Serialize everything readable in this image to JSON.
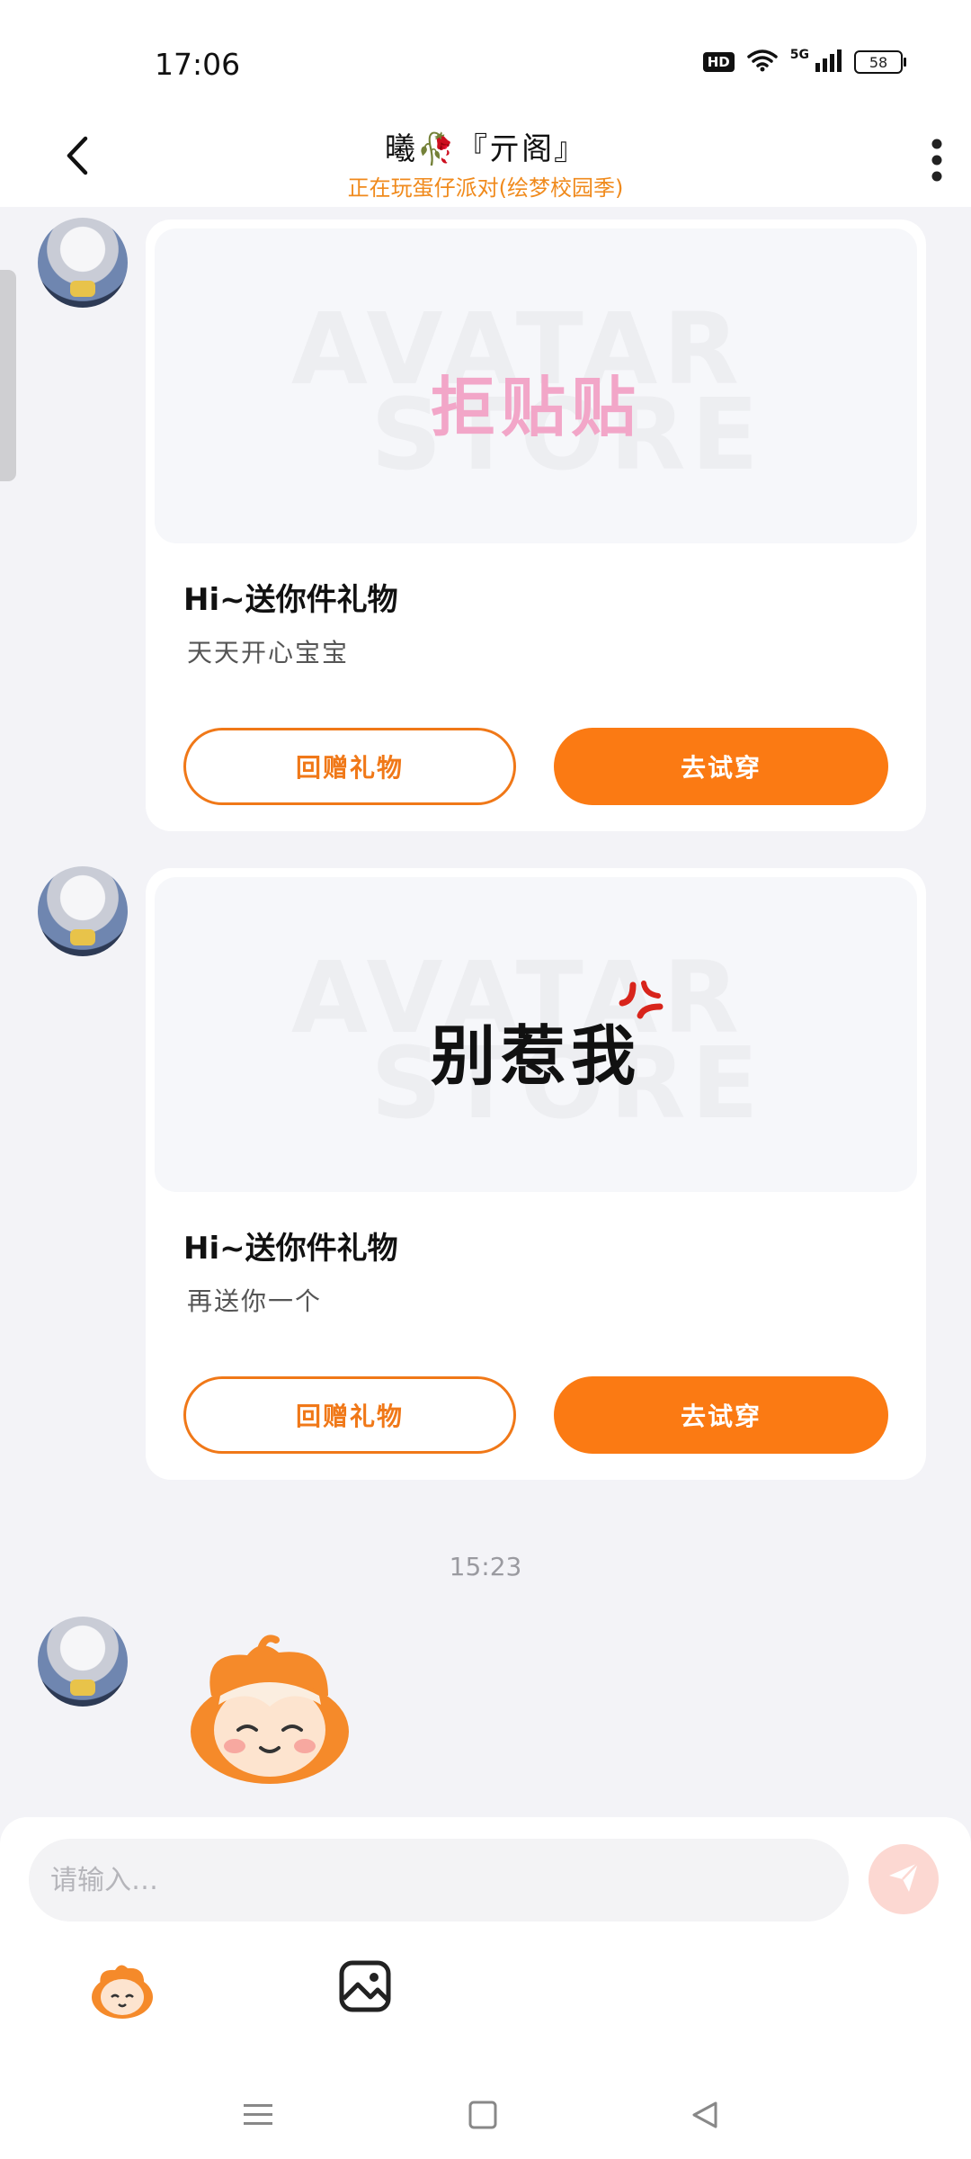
{
  "status_bar": {
    "time": "17:06",
    "hd_label": "HD",
    "network_label": "5G",
    "battery_level": "58"
  },
  "header": {
    "title": "曦🥀『亓阁』",
    "status": "正在玩蛋仔派对(绘梦校园季)"
  },
  "messages": [
    {
      "type": "gift",
      "image_text": "拒贴贴",
      "watermark_line1": "AVATAR",
      "watermark_line2": "STORE",
      "title": "Hi~送你件礼物",
      "subtitle": "天天开心宝宝",
      "return_label": "回赠礼物",
      "try_label": "去试穿"
    },
    {
      "type": "gift",
      "image_text": "别惹我",
      "watermark_line1": "AVATAR",
      "watermark_line2": "STORE",
      "title": "Hi~送你件礼物",
      "subtitle": "再送你一个",
      "return_label": "回赠礼物",
      "try_label": "去试穿"
    }
  ],
  "timestamp": "15:23",
  "input": {
    "placeholder": "请输入…"
  },
  "colors": {
    "accent": "#fb7a13",
    "status_text": "#f08a1c",
    "background": "#f3f3f7"
  },
  "icons": {
    "back": "chevron-left-icon",
    "more": "more-vertical-icon",
    "send": "paper-plane-icon",
    "emoji": "mascot-emoji-icon",
    "image": "image-icon",
    "nav_menu": "menu-icon",
    "nav_home": "square-icon",
    "nav_back": "triangle-back-icon"
  }
}
